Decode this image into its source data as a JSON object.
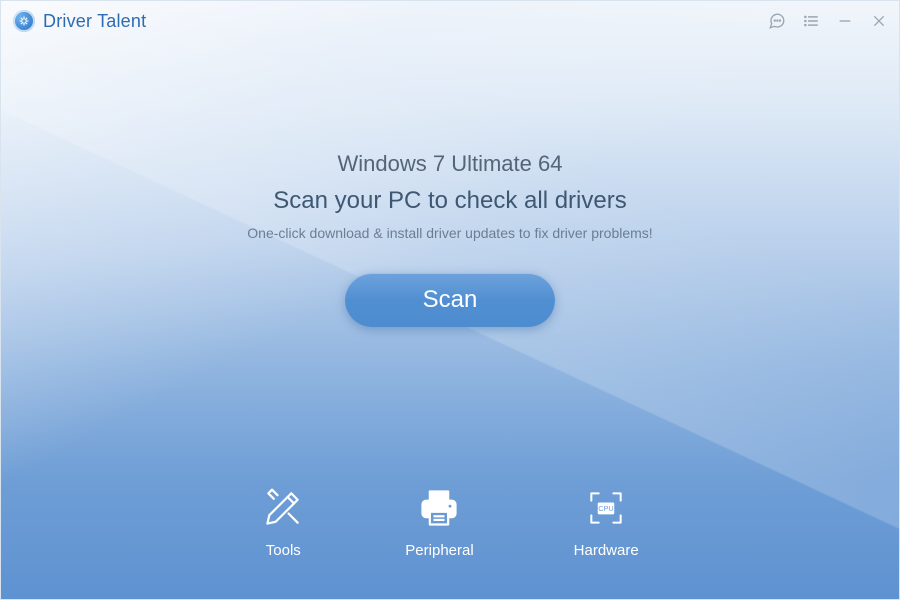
{
  "app": {
    "title": "Driver Talent"
  },
  "hero": {
    "os_name": "Windows 7",
    "os_edition": "Ultimate",
    "os_arch": "64",
    "headline": "Scan your PC to check all drivers",
    "subline": "One-click download & install driver updates to fix driver problems!",
    "scan_label": "Scan"
  },
  "nav": [
    {
      "id": "tools",
      "label": "Tools",
      "icon": "tools-icon"
    },
    {
      "id": "peripheral",
      "label": "Peripheral",
      "icon": "printer-icon"
    },
    {
      "id": "hardware",
      "label": "Hardware",
      "icon": "cpu-icon"
    }
  ],
  "window_controls": {
    "feedback": "feedback",
    "menu": "menu",
    "minimize": "minimize",
    "close": "close"
  },
  "colors": {
    "accent": "#2d6bb3",
    "button_top": "#6ea3dc",
    "button_bottom": "#4e8cd0",
    "text_primary": "#3e5872",
    "text_secondary": "#6a7e92"
  }
}
